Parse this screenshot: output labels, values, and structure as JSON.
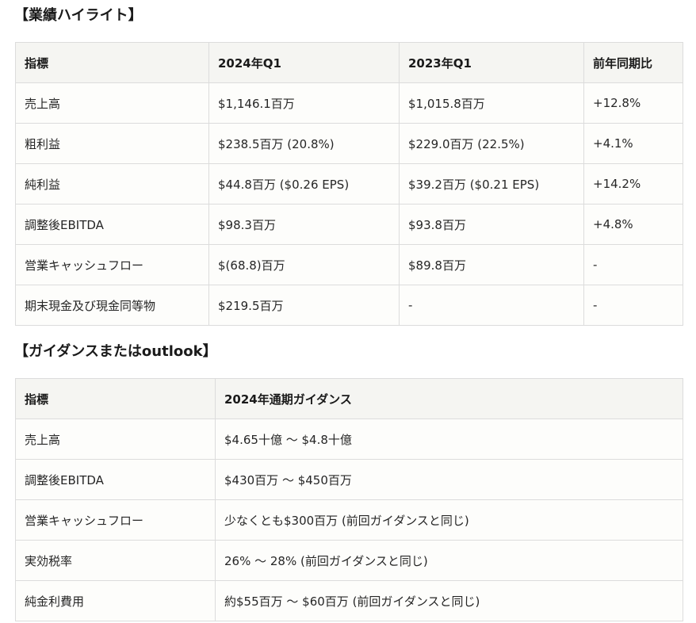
{
  "highlights": {
    "title": "【業績ハイライト】",
    "headers": [
      "指標",
      "2024年Q1",
      "2023年Q1",
      "前年同期比"
    ],
    "rows": [
      [
        "売上高",
        "$1,146.1百万",
        "$1,015.8百万",
        "+12.8%"
      ],
      [
        "粗利益",
        "$238.5百万 (20.8%)",
        "$229.0百万 (22.5%)",
        "+4.1%"
      ],
      [
        "純利益",
        "$44.8百万 ($0.26 EPS)",
        "$39.2百万 ($0.21 EPS)",
        "+14.2%"
      ],
      [
        "調整後EBITDA",
        "$98.3百万",
        "$93.8百万",
        "+4.8%"
      ],
      [
        "営業キャッシュフロー",
        "$(68.8)百万",
        "$89.8百万",
        "-"
      ],
      [
        "期末現金及び現金同等物",
        "$219.5百万",
        "-",
        "-"
      ]
    ]
  },
  "guidance": {
    "title": "【ガイダンスまたはoutlook】",
    "headers": [
      "指標",
      "2024年通期ガイダンス"
    ],
    "rows": [
      [
        "売上高",
        "$4.65十億 ～ $4.8十億"
      ],
      [
        "調整後EBITDA",
        "$430百万 ～ $450百万"
      ],
      [
        "営業キャッシュフロー",
        "少なくとも$300百万 (前回ガイダンスと同じ)"
      ],
      [
        "実効税率",
        "26% ～ 28% (前回ガイダンスと同じ)"
      ],
      [
        "純金利費用",
        "約$55百万 ～ $60百万 (前回ガイダンスと同じ)"
      ]
    ]
  }
}
